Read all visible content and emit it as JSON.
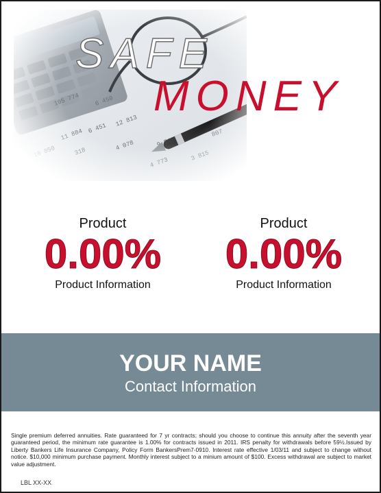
{
  "hero": {
    "image": "calculator-glasses-pen-financial-papers",
    "title_line1": "SAFE",
    "title_line2": "MONEY"
  },
  "products": [
    {
      "name": "Product",
      "rate": "0.00%",
      "info": "Product Information"
    },
    {
      "name": "Product",
      "rate": "0.00%",
      "info": "Product Information"
    }
  ],
  "contact": {
    "name": "YOUR NAME",
    "info": "Contact Information"
  },
  "disclaimer": "Single premium deferred annuities. Rate guaranteed for 7 yr contracts; should you choose to continue this annuity after the seventh year guaranteed period, the minimum rate guarantee is 1.00% for contracts issued in 2011. IRS penalty for withdrawals before 59½.Issued by Liberty Bankers Life Insurance Company, Policy Form BankersPrem7-0910. Interest rate effective 1/03/11 and subject to change without notice. $10,000 minimum purchase payment. Monthly interest subject to a minium amount of $100. Excess withdrawal are subject to market value adjustment.",
  "label_code": "LBL XX-XX",
  "colors": {
    "accent_red": "#c8102e",
    "band": "#768a95"
  }
}
